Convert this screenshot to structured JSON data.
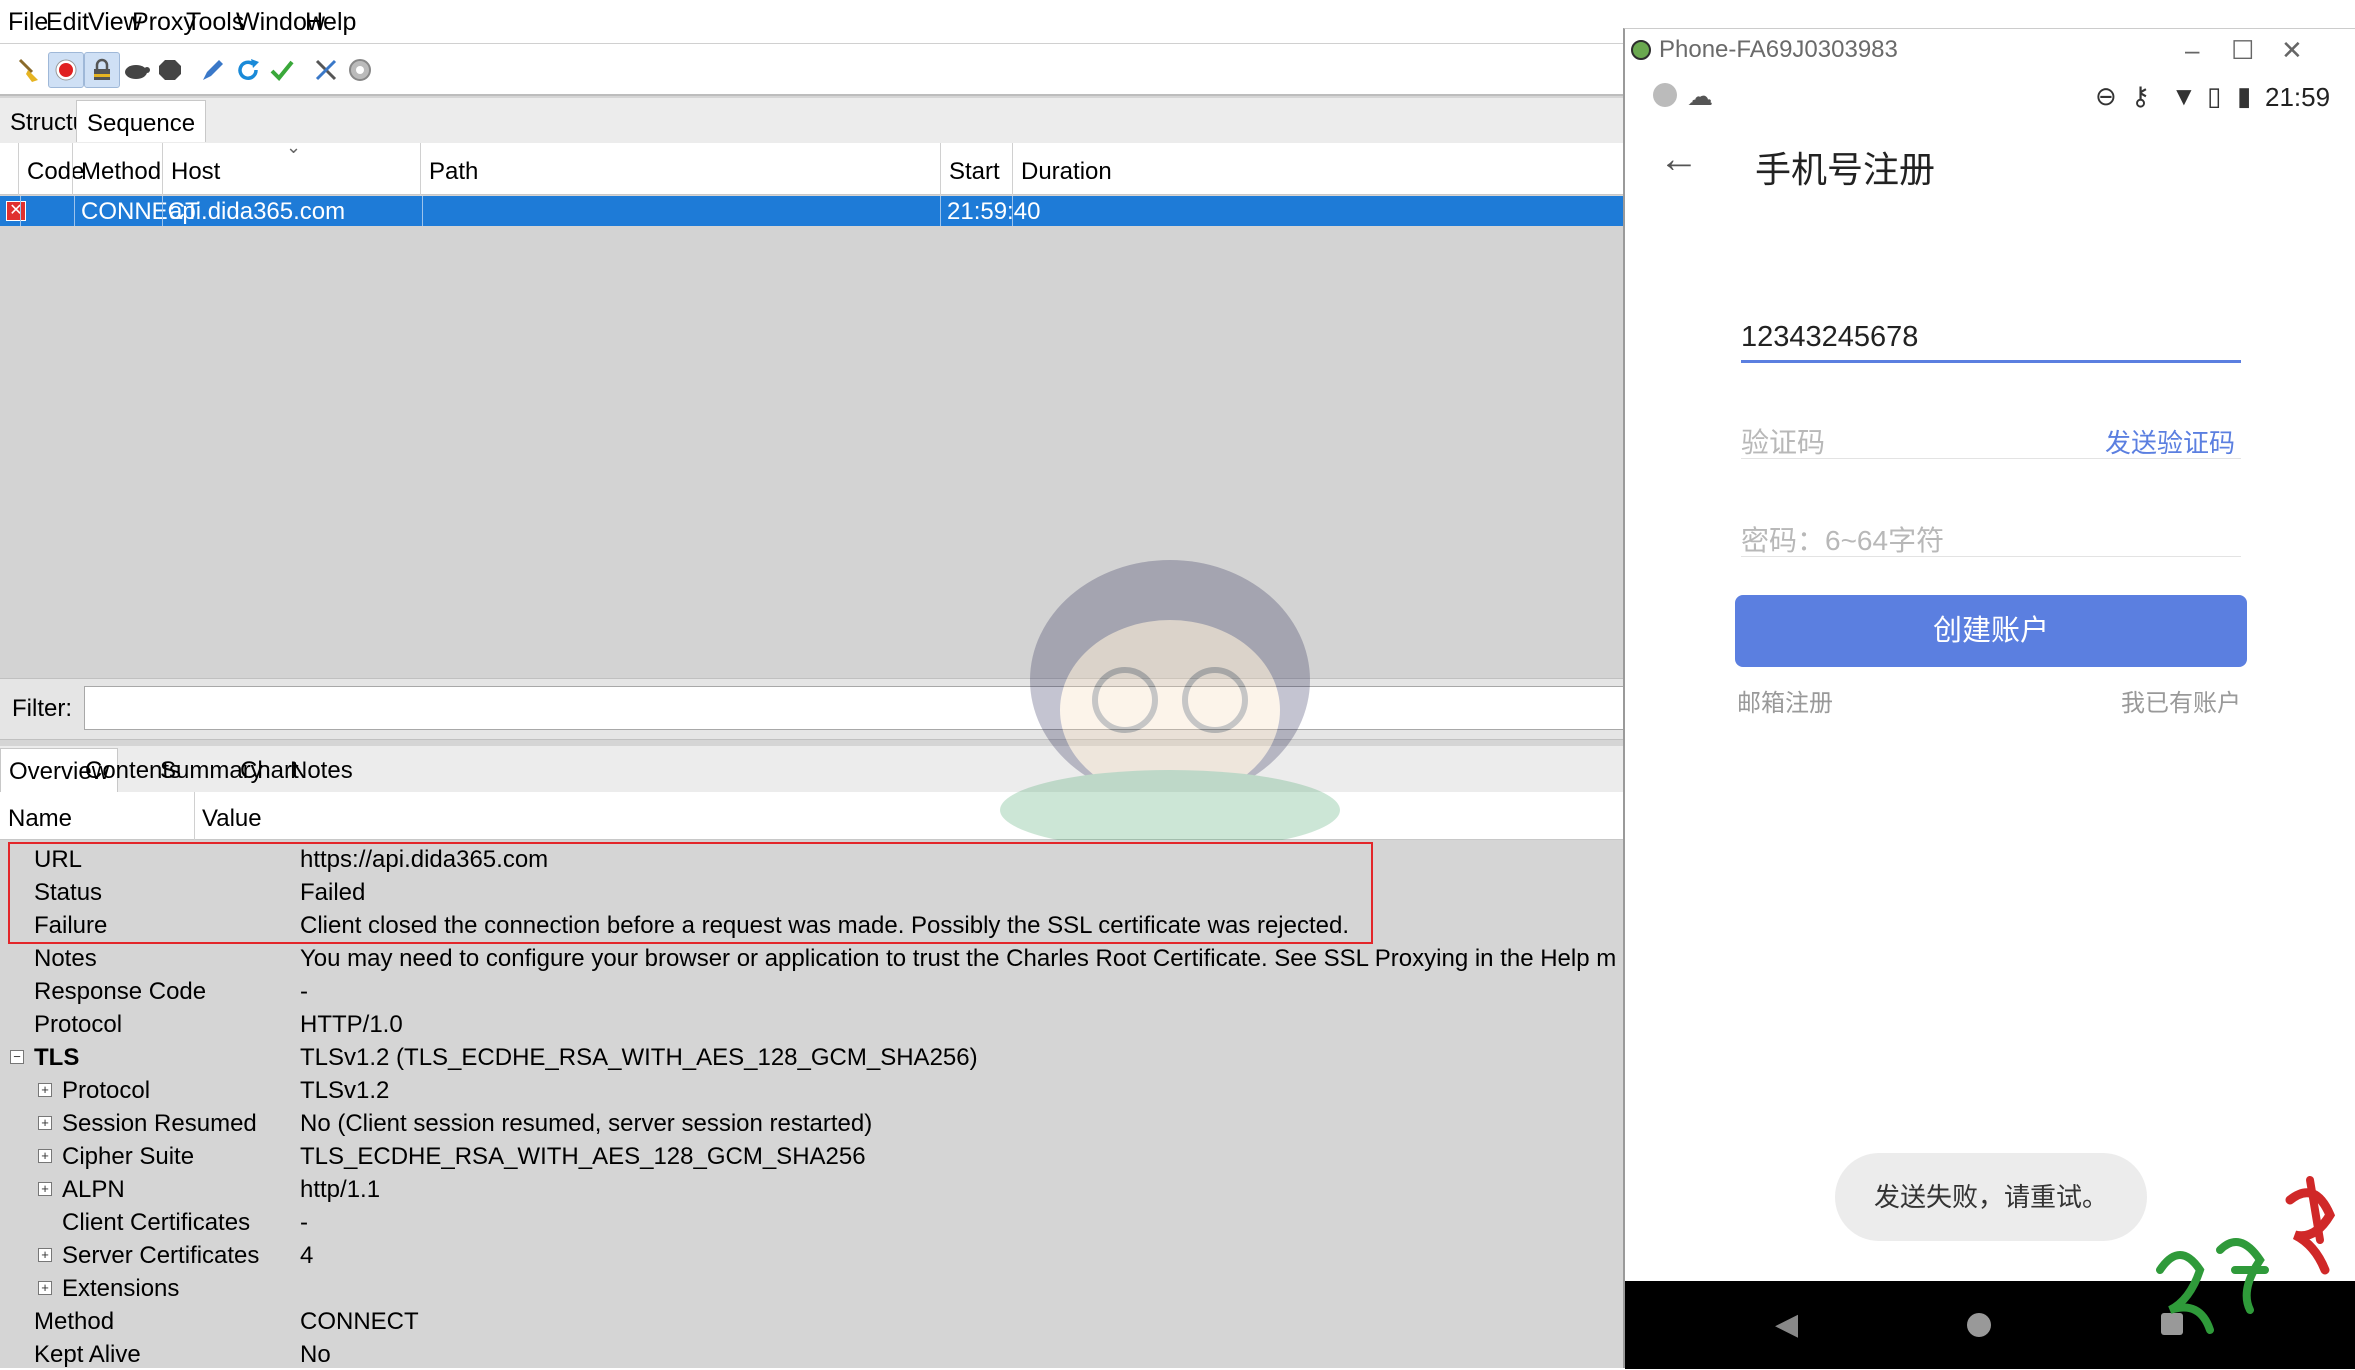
{
  "menubar": {
    "items": [
      "File",
      "Edit",
      "View",
      "Proxy",
      "Tools",
      "Window",
      "Help"
    ]
  },
  "toolbar": {
    "icons": [
      "broom-icon",
      "record-icon",
      "ssl-proxy-icon",
      "throttle-icon",
      "breakpoint-icon",
      "compose-icon",
      "repeat-icon",
      "validate-icon",
      "tools-icon",
      "settings-icon"
    ]
  },
  "viewtabs": {
    "structure": "Structure",
    "sequence": "Sequence"
  },
  "columns": {
    "code": "Code",
    "method": "Method",
    "host": "Host",
    "path": "Path",
    "start": "Start",
    "duration": "Duration"
  },
  "selected_row": {
    "code": "",
    "method": "CONNECT",
    "host": "api.dida365.com",
    "path": "",
    "start": "21:59:40",
    "duration": ""
  },
  "filter": {
    "label": "Filter:",
    "value": ""
  },
  "detail_tabs": [
    "Overview",
    "Contents",
    "Summary",
    "Chart",
    "Notes"
  ],
  "overview_header": {
    "name": "Name",
    "value": "Value"
  },
  "overview_rows": [
    {
      "name": "URL",
      "value": "https://api.dida365.com"
    },
    {
      "name": "Status",
      "value": "Failed"
    },
    {
      "name": "Failure",
      "value": "Client closed the connection before a request was made. Possibly the SSL certificate was rejected."
    },
    {
      "name": "Notes",
      "value": "You may need to configure your browser or application to trust the Charles Root Certificate. See SSL Proxying in the Help m"
    },
    {
      "name": "Response Code",
      "value": "-"
    },
    {
      "name": "Protocol",
      "value": "HTTP/1.0"
    },
    {
      "name": "TLS",
      "value": "TLSv1.2 (TLS_ECDHE_RSA_WITH_AES_128_GCM_SHA256)"
    },
    {
      "name": "Protocol",
      "value": "TLSv1.2"
    },
    {
      "name": "Session Resumed",
      "value": "No (Client session resumed, server session restarted)"
    },
    {
      "name": "Cipher Suite",
      "value": "TLS_ECDHE_RSA_WITH_AES_128_GCM_SHA256"
    },
    {
      "name": "ALPN",
      "value": "http/1.1"
    },
    {
      "name": "Client Certificates",
      "value": "-"
    },
    {
      "name": "Server Certificates",
      "value": "4"
    },
    {
      "name": "Extensions",
      "value": ""
    },
    {
      "name": "Method",
      "value": "CONNECT"
    },
    {
      "name": "Kept Alive",
      "value": "No"
    }
  ],
  "phone": {
    "window_title": "Phone-FA69J0303983",
    "status_time": "21:59",
    "screen_title": "手机号注册",
    "phone_number": "12343245678",
    "code_placeholder": "验证码",
    "send_code": "发送验证码",
    "password_placeholder": "密码：6~64字符",
    "create_button": "创建账户",
    "email_register": "邮箱注册",
    "have_account": "我已有账户",
    "toast": "发送失败，请重试。"
  },
  "colors": {
    "selection": "#1e7bd7",
    "accent": "#5b7fe0",
    "error_box": "#e3262a"
  }
}
